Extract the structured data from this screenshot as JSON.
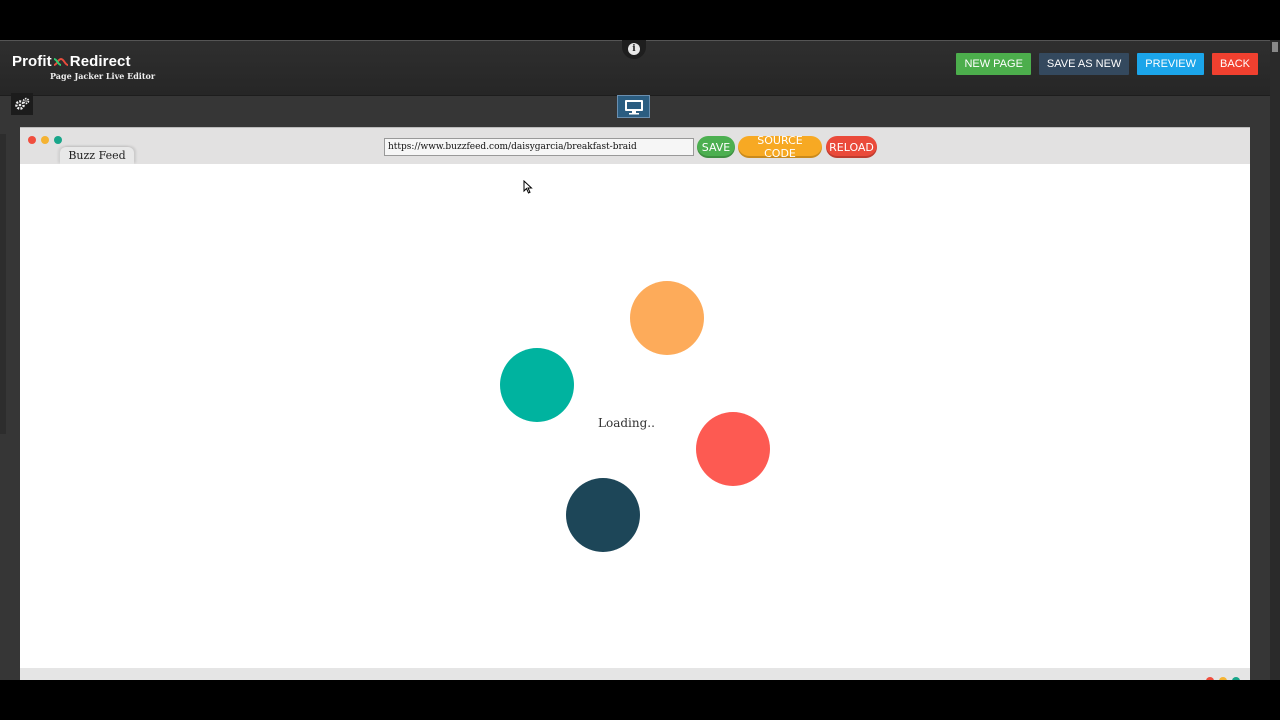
{
  "brand": {
    "name_left": "Profit",
    "name_right": "Redirect",
    "subtitle": "Page Jacker Live Editor"
  },
  "header": {
    "info_glyph": "i",
    "actions": [
      {
        "label": "NEW PAGE",
        "color": "#4cae4c"
      },
      {
        "label": "SAVE AS NEW",
        "color": "#34495e"
      },
      {
        "label": "PREVIEW",
        "color": "#1ba5ea"
      },
      {
        "label": "BACK",
        "color": "#f0402f"
      }
    ]
  },
  "toolbar": {
    "settings_icon": "gears-icon",
    "device_icon": "desktop-monitor-icon"
  },
  "browser": {
    "tab_title": "Buzz Feed",
    "url": "https://www.buzzfeed.com/daisygarcia/breakfast-braid",
    "buttons": {
      "save": "SAVE",
      "source": "SOURCE CODE",
      "reload": "RELOAD"
    },
    "loading_text": "Loading..",
    "loader_colors": [
      "#fdab5a",
      "#00b39f",
      "#fd5a52",
      "#1d4658"
    ]
  }
}
